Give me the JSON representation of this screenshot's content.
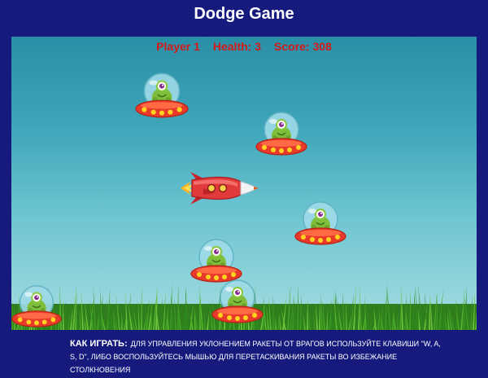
{
  "title": "Dodge Game",
  "hud": {
    "player": "Player 1",
    "health": "Health: 3",
    "score": "Score: 308"
  },
  "help": {
    "lead": "КАК ИГРАТЬ:",
    "text": "ДЛЯ УПРАВЛЕНИЯ УКЛОНЕНИЕМ РАКЕТЫ ОТ ВРАГОВ ИСПОЛЬЗУЙТЕ КЛАВИШИ \"W, A, S, D\", ЛИБО ВОСПОЛЬЗУЙТЕСЬ МЫШЬЮ ДЛЯ ПЕРЕТАСКИВАНИЯ РАКЕТЫ ВО ИЗБЕЖАНИЕ СТОЛКНОВЕНИЯ"
  },
  "sprites": {
    "player": "rocket-icon",
    "enemy": "alien-ufo-icon"
  }
}
